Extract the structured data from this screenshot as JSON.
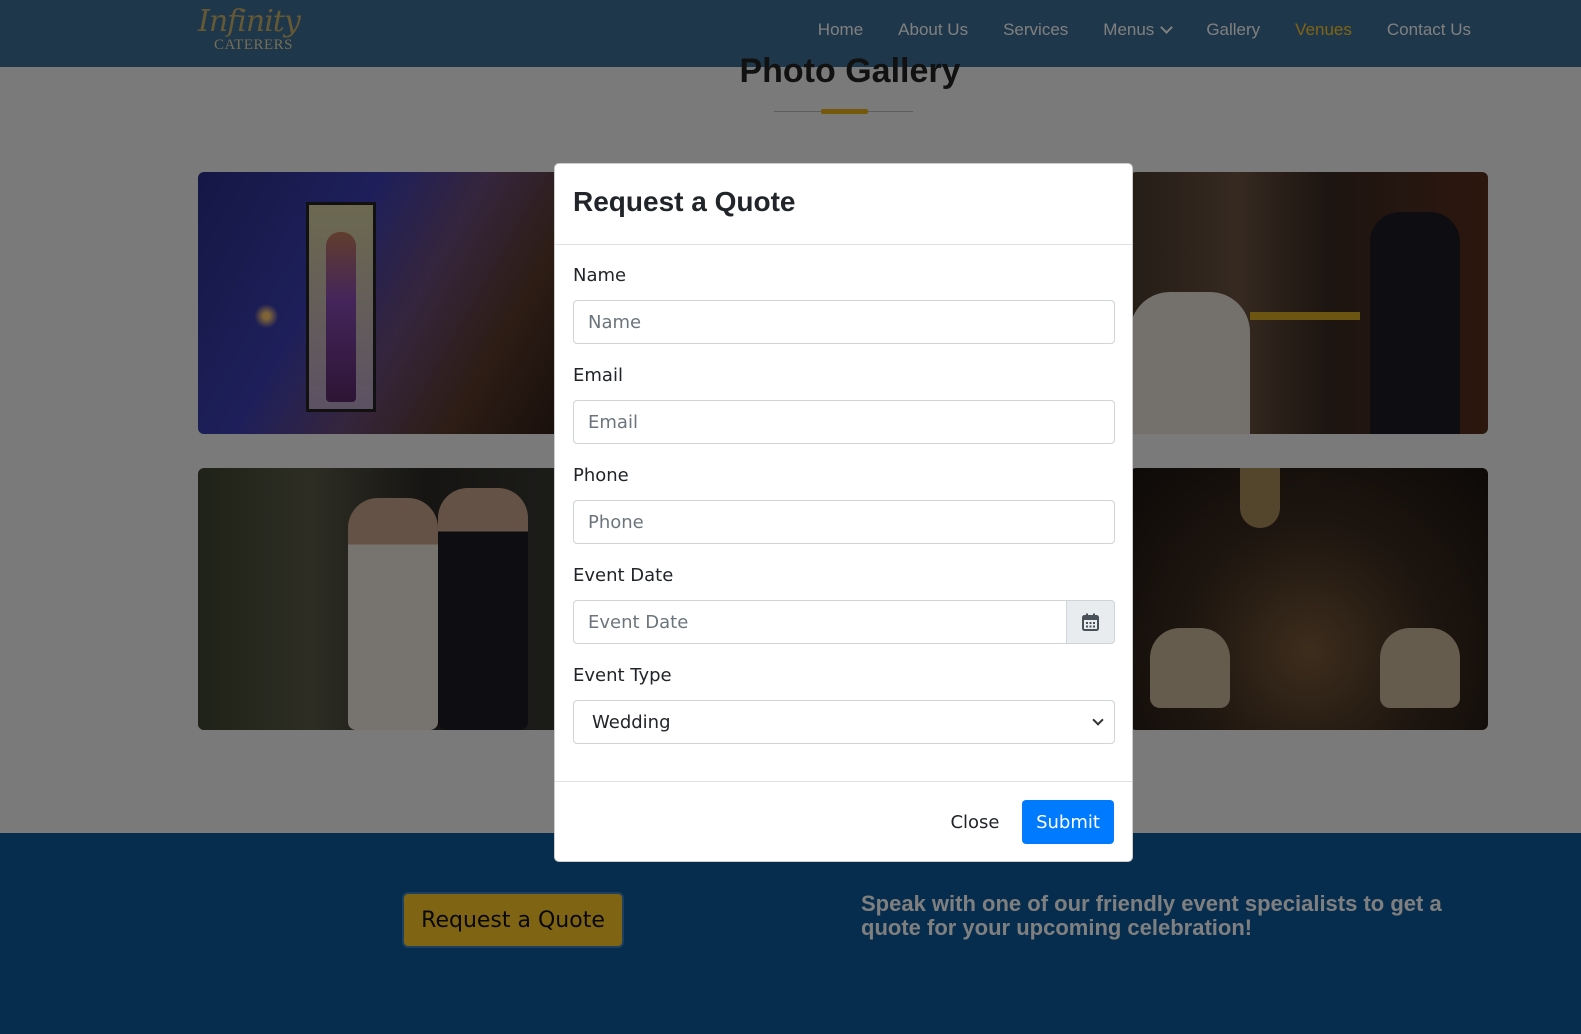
{
  "brand": {
    "logo_line1": "Infinity",
    "logo_line2": "CATERERS"
  },
  "nav": {
    "items": [
      {
        "label": "Home"
      },
      {
        "label": "About Us"
      },
      {
        "label": "Services"
      },
      {
        "label": "Menus"
      },
      {
        "label": "Gallery"
      },
      {
        "label": "Venues"
      },
      {
        "label": "Contact Us"
      }
    ],
    "active_item": "Venues",
    "dropdown_item": "Menus"
  },
  "gallery": {
    "title": "Photo Gallery"
  },
  "cta": {
    "button_label": "Request a Quote",
    "text": "Speak with one of our friendly event specialists to get a quote for your upcoming celebration!"
  },
  "modal": {
    "title": "Request a Quote",
    "fields": {
      "name": {
        "label": "Name",
        "placeholder": "Name",
        "value": ""
      },
      "email": {
        "label": "Email",
        "placeholder": "Email",
        "value": ""
      },
      "phone": {
        "label": "Phone",
        "placeholder": "Phone",
        "value": ""
      },
      "event_date": {
        "label": "Event Date",
        "placeholder": "Event Date",
        "value": ""
      },
      "event_type": {
        "label": "Event Type",
        "selected": "Wedding"
      }
    },
    "close_label": "Close",
    "submit_label": "Submit"
  },
  "icons": {
    "calendar": "calendar-icon",
    "dropdown": "chevron-down-icon"
  },
  "colors": {
    "navbar": "#3f6f94",
    "accent_gold": "#ffc928",
    "cta_background": "#0c5a9a",
    "primary_button": "#007bff"
  }
}
